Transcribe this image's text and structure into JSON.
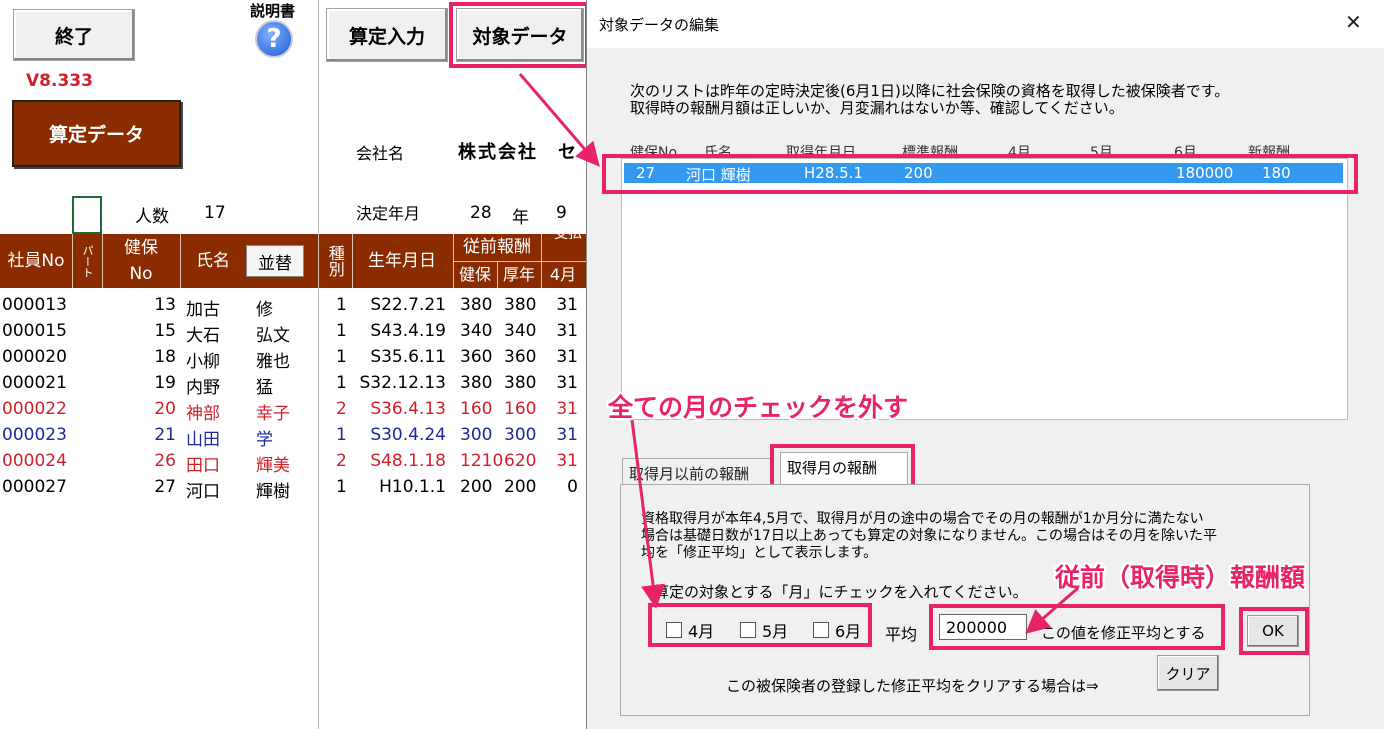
{
  "main": {
    "exit_label": "終了",
    "manual_label": "説明書",
    "version": "V8.333",
    "santei_data_label": "算定データ",
    "santei_input_label": "算定入力",
    "taisho_data_label": "対象データ",
    "company_label": "会社名",
    "company_name": "株式会社　セ",
    "headcount_label": "人数",
    "headcount_value": "17",
    "decision_label": "決定年月",
    "decision_year": "28",
    "year_unit": "年",
    "decision_month": "9",
    "headers": {
      "emp_no": "社員No",
      "part": "パート",
      "kenpo_no_1": "健保",
      "kenpo_no_2": "No",
      "name": "氏名",
      "sort_button": "並替",
      "kind": "種別",
      "birth": "生年月日",
      "prev_pay": "従前報酬",
      "kenpo": "健保",
      "kosei": "厚年",
      "april": "4月",
      "cut_top": "支払"
    },
    "rows": [
      {
        "emp": "000013",
        "kno": "13",
        "last": "加古",
        "first": "修",
        "kind": "1",
        "birth": "S22.7.21",
        "kp": "380",
        "kn": "380",
        "a": "31",
        "color": "black"
      },
      {
        "emp": "000015",
        "kno": "15",
        "last": "大石",
        "first": "弘文",
        "kind": "1",
        "birth": "S43.4.19",
        "kp": "340",
        "kn": "340",
        "a": "31",
        "color": "black"
      },
      {
        "emp": "000020",
        "kno": "18",
        "last": "小柳",
        "first": "雅也",
        "kind": "1",
        "birth": "S35.6.11",
        "kp": "360",
        "kn": "360",
        "a": "31",
        "color": "black"
      },
      {
        "emp": "000021",
        "kno": "19",
        "last": "内野",
        "first": "猛",
        "kind": "1",
        "birth": "S32.12.13",
        "kp": "380",
        "kn": "380",
        "a": "31",
        "color": "black"
      },
      {
        "emp": "000022",
        "kno": "20",
        "last": "神部",
        "first": "幸子",
        "kind": "2",
        "birth": "S36.4.13",
        "kp": "160",
        "kn": "160",
        "a": "31",
        "color": "red"
      },
      {
        "emp": "000023",
        "kno": "21",
        "last": "山田",
        "first": "学",
        "kind": "1",
        "birth": "S30.4.24",
        "kp": "300",
        "kn": "300",
        "a": "31",
        "color": "blue"
      },
      {
        "emp": "000024",
        "kno": "26",
        "last": "田口",
        "first": "輝美",
        "kind": "2",
        "birth": "S48.1.18",
        "kp": "1210",
        "kn": "620",
        "a": "31",
        "color": "red"
      },
      {
        "emp": "000027",
        "kno": "27",
        "last": "河口",
        "first": "輝樹",
        "kind": "1",
        "birth": "H10.1.1",
        "kp": "200",
        "kn": "200",
        "a": "0",
        "color": "black"
      }
    ]
  },
  "dialog": {
    "title": "対象データの編集",
    "close_glyph": "✕",
    "intro_line1": "次のリストは昨年の定時決定後(6月1日)以降に社会保険の資格を取得した被保険者です。",
    "intro_line2": "取得時の報酬月額は正しいか、月変漏れはないか等、確認してください。",
    "columns": [
      "健保No",
      "氏名",
      "取得年月日",
      "標準報酬",
      "4月",
      "5月",
      "6月",
      "新報酬"
    ],
    "selected_row": {
      "kno": "27",
      "name": "河口 輝樹",
      "date": "H28.5.1",
      "std": "200",
      "jun": "180000",
      "new": "180"
    },
    "tab_before": "取得月以前の報酬",
    "tab_month": "取得月の報酬",
    "desc_line1": "資格取得月が本年4,5月で、取得月が月の途中の場合でその月の報酬が1か月分に満たない",
    "desc_line2": "場合は基礎日数が17日以上あっても算定の対象になりません。この場合はその月を除いた平",
    "desc_line3": "均を「修正平均」として表示します。",
    "check_prompt": "算定の対象とする「月」にチェックを入れてください。",
    "check_april": "4月",
    "check_may": "5月",
    "check_june": "6月",
    "avg_label": "平均",
    "avg_value": "200000",
    "avg_suffix": "この値を修正平均とする",
    "ok_label": "OK",
    "clear_prompt": "この被保険者の登録した修正平均をクリアする場合は⇒",
    "clear_label": "クリア"
  },
  "annotations": {
    "uncheck_all": "全ての月のチェックを外す",
    "prev_pay": "従前（取得時）報酬額"
  },
  "colors": {
    "header_bg": "#8a2c00",
    "accent": "#e8236a",
    "selection": "#3399ee"
  }
}
